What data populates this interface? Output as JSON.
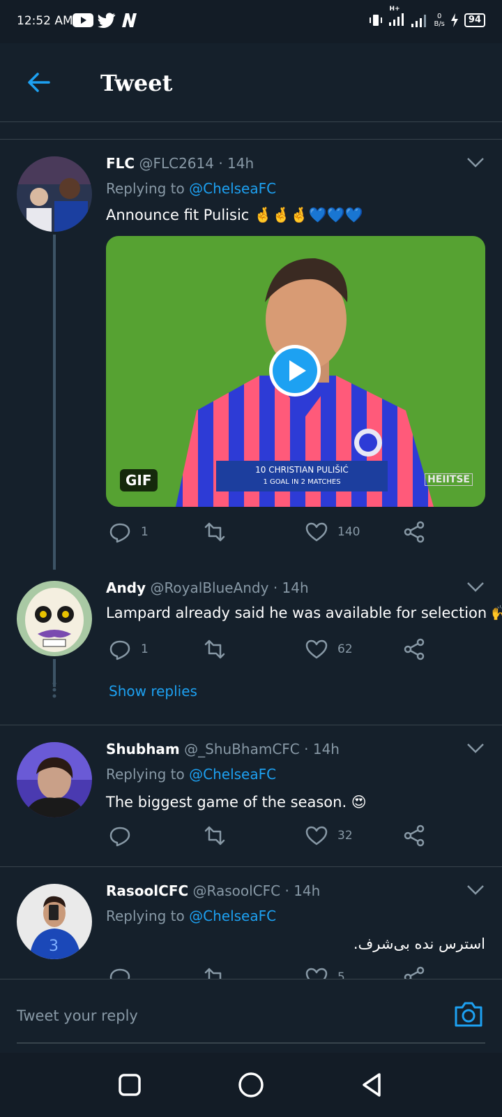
{
  "status_bar": {
    "time": "12:52 AM",
    "net_speed_value": "0",
    "net_speed_unit": "B/s",
    "battery": "94",
    "network_type": "H+"
  },
  "header": {
    "title": "Tweet"
  },
  "tweets": [
    {
      "name": "FLC",
      "handle": "@FLC2614",
      "time": "· 14h",
      "replying_label": "Replying to",
      "replying_to": "@ChelseaFC",
      "text": "Announce fit Pulisic 🤞🤞🤞💙💙💙",
      "media": {
        "badge": "GIF",
        "caption_line1": "10 CHRISTIAN PULIŠIĆ",
        "caption_line2": "1 GOAL IN 2 MATCHES",
        "watermark": "HEIITSE"
      },
      "replies": "1",
      "retweets": "",
      "likes": "140"
    },
    {
      "name": "Andy",
      "handle": "@RoyalBlueAndy",
      "time": "· 14h",
      "text": "Lampard already said he was available for selection 🙌",
      "replies": "1",
      "retweets": "",
      "likes": "62",
      "show_replies": "Show replies"
    },
    {
      "name": "Shubham",
      "handle": "@_ShuBhamCFC",
      "time": "· 14h",
      "replying_label": "Replying to",
      "replying_to": "@ChelseaFC",
      "text": "The biggest game of the season. 😍",
      "replies": "",
      "retweets": "",
      "likes": "32"
    },
    {
      "name": "RasoolCFC",
      "handle": "@RasoolCFC",
      "time": "· 14h",
      "replying_label": "Replying to",
      "replying_to": "@ChelseaFC",
      "text": "استرس نده بی‌شرف.",
      "replies": "",
      "retweets": "",
      "likes": "5"
    }
  ],
  "reply_box": {
    "placeholder": "Tweet your reply"
  },
  "colors": {
    "background": "#15202b",
    "accent": "#1da1f2",
    "muted": "#8899a6",
    "divider": "#38444d"
  },
  "icons": [
    "back-arrow-icon",
    "chevron-down-icon",
    "reply-icon",
    "retweet-icon",
    "like-icon",
    "share-icon",
    "camera-icon",
    "play-icon",
    "nav-square-icon",
    "nav-circle-icon",
    "nav-back-triangle-icon"
  ]
}
